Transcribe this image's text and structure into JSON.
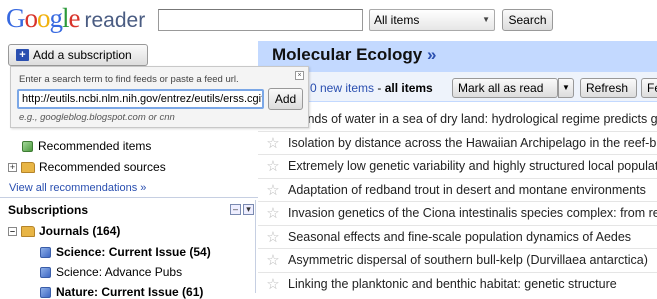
{
  "header": {
    "logo_google": "Google",
    "logo_reader": "reader",
    "search_value": "",
    "scope": "All items",
    "search_button": "Search"
  },
  "add_subscription": {
    "label": "Add a subscription",
    "hint": "Enter a search term to find feeds or paste a feed url.",
    "url_value": "http://eutils.ncbi.nlm.nih.gov/entrez/eutils/erss.cgi?rss_guid=",
    "add_button": "Add",
    "example": "e.g., googleblog.blogspot.com or cnn"
  },
  "nav": {
    "recommended_items": "Recommended items",
    "recommended_sources": "Recommended sources",
    "view_all": "View all recommendations »",
    "subscriptions_header": "Subscriptions",
    "folder": "Journals (164)",
    "feeds": [
      "Science: Current Issue (54)",
      "Science: Advance Pubs",
      "Nature: Current Issue (61)"
    ]
  },
  "main": {
    "title": "Molecular Ecology",
    "title_suffix": "»",
    "new_items": "0 new items",
    "separator": " - ",
    "all_items": "all items",
    "mark_all_read": "Mark all as read",
    "refresh": "Refresh",
    "feed_settings": "Feed settings...",
    "entries": [
      "Islands of water in a sea of dry land: hydrological regime predicts genetic diversity",
      "Isolation by distance across the Hawaiian Archipelago in the reef-building coral",
      "Extremely low genetic variability and highly structured local populations",
      "Adaptation of redband trout in desert and montane environments",
      "Invasion genetics of the Ciona intestinalis species complex: from regional endemism",
      "Seasonal effects and fine-scale population dynamics of Aedes",
      "Asymmetric dispersal of southern bull-kelp (Durvillaea antarctica)",
      "Linking the planktonic and benthic habitat: genetic structure"
    ]
  },
  "colors": {
    "header_band": "#c3d9ff",
    "link": "#2a4fb0"
  }
}
